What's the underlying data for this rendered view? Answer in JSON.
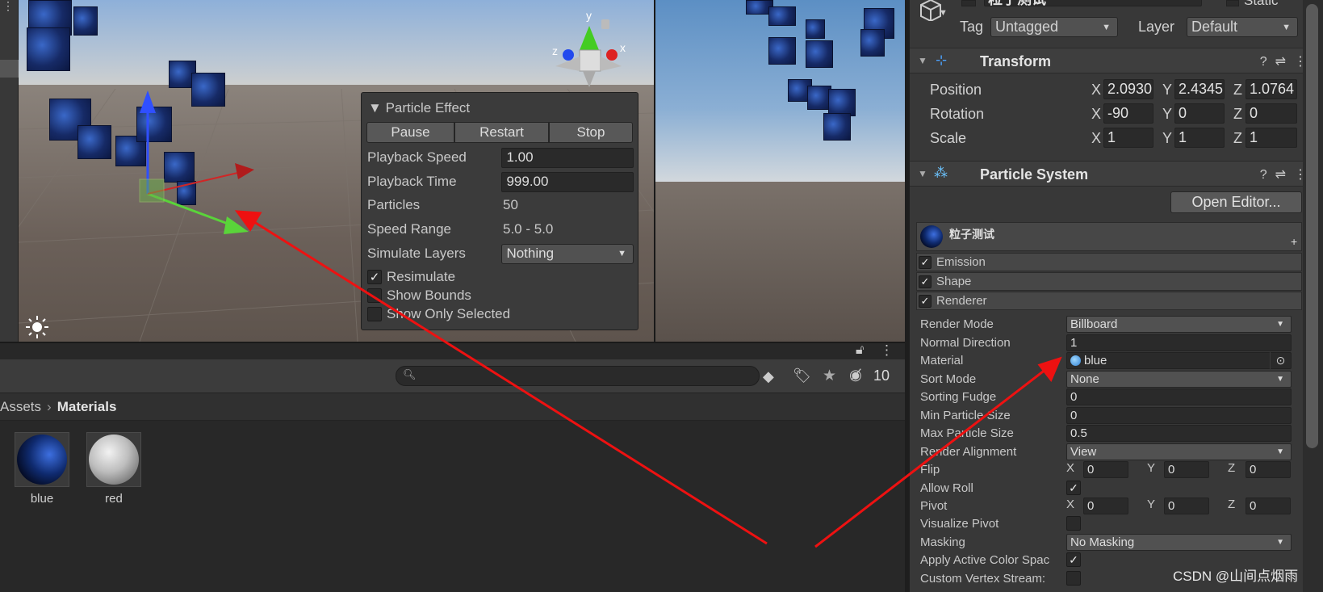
{
  "particle_effect": {
    "title": "Particle Effect",
    "pause": "Pause",
    "restart": "Restart",
    "stop": "Stop",
    "playback_speed_label": "Playback Speed",
    "playback_speed": "1.00",
    "playback_time_label": "Playback Time",
    "playback_time": "999.00",
    "particles_label": "Particles",
    "particles": "50",
    "speed_range_label": "Speed Range",
    "speed_range": "5.0 - 5.0",
    "simulate_layers_label": "Simulate Layers",
    "simulate_layers": "Nothing",
    "resimulate": "Resimulate",
    "resimulate_checked": true,
    "show_bounds": "Show Bounds",
    "show_only_selected": "Show Only Selected"
  },
  "gizmo": {
    "y": "y",
    "x": "x",
    "z": "z"
  },
  "project": {
    "search_placeholder": "",
    "hidden_count": "10",
    "breadcrumb_root": "Assets",
    "breadcrumb_current": "Materials",
    "assets": [
      {
        "name": "blue",
        "color": "#0f2a6e"
      },
      {
        "name": "red",
        "color": "#bdbdbd"
      }
    ]
  },
  "inspector": {
    "object_name": "粒子测试",
    "static_label": "Static",
    "tag_label": "Tag",
    "tag_value": "Untagged",
    "layer_label": "Layer",
    "layer_value": "Default",
    "transform": {
      "title": "Transform",
      "position_label": "Position",
      "rotation_label": "Rotation",
      "scale_label": "Scale",
      "position": [
        "2.0930",
        "2.4345",
        "1.0764"
      ],
      "rotation": [
        "-90",
        "0",
        "0"
      ],
      "scale": [
        "1",
        "1",
        "1"
      ],
      "axes": [
        "X",
        "Y",
        "Z"
      ]
    },
    "particle_system": {
      "title": "Particle System",
      "open_editor": "Open Editor...",
      "system_name": "粒子测试",
      "modules": [
        "Emission",
        "Shape",
        "Renderer"
      ],
      "renderer": {
        "render_mode_label": "Render Mode",
        "render_mode": "Billboard",
        "normal_direction_label": "Normal Direction",
        "normal_direction": "1",
        "material_label": "Material",
        "material": "blue",
        "sort_mode_label": "Sort Mode",
        "sort_mode": "None",
        "sorting_fudge_label": "Sorting Fudge",
        "sorting_fudge": "0",
        "min_particle_size_label": "Min Particle Size",
        "min_particle_size": "0",
        "max_particle_size_label": "Max Particle Size",
        "max_particle_size": "0.5",
        "render_alignment_label": "Render Alignment",
        "render_alignment": "View",
        "flip_label": "Flip",
        "flip": [
          "0",
          "0",
          "0"
        ],
        "allow_roll_label": "Allow Roll",
        "pivot_label": "Pivot",
        "pivot": [
          "0",
          "0",
          "0"
        ],
        "visualize_pivot_label": "Visualize Pivot",
        "masking_label": "Masking",
        "masking": "No Masking",
        "apply_active_color_label": "Apply Active Color Spac",
        "custom_vertex_label": "Custom Vertex Stream:"
      }
    }
  },
  "watermark": "CSDN @山间点烟雨",
  "colors": {
    "annotation_arrow": "#ee1111",
    "panel_bg": "#383838",
    "field_bg": "#2a2a2a"
  }
}
